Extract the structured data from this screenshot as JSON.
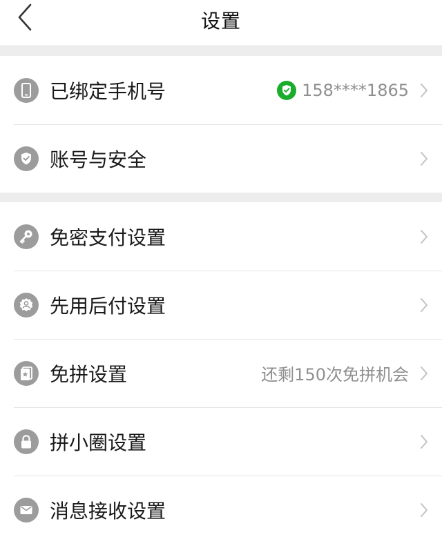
{
  "header": {
    "title": "设置",
    "back_icon": "chevron-left-icon"
  },
  "sections": [
    {
      "items": [
        {
          "label": "已绑定手机号",
          "icon": "phone-icon",
          "value": "158****1865",
          "value_icon": "verified-shield-icon",
          "value_icon_color": "#1aad2b"
        },
        {
          "label": "账号与安全",
          "icon": "shield-check-icon"
        }
      ]
    },
    {
      "items": [
        {
          "label": "免密支付设置",
          "icon": "key-icon"
        },
        {
          "label": "先用后付设置",
          "icon": "badge-person-icon"
        },
        {
          "label": "免拼设置",
          "icon": "card-star-icon",
          "value": "还剩150次免拼机会"
        },
        {
          "label": "拼小圈设置",
          "icon": "lock-icon"
        },
        {
          "label": "消息接收设置",
          "icon": "mail-icon"
        }
      ]
    }
  ],
  "colors": {
    "icon_bg": "#9c9c9c",
    "section_gap": "#ededed",
    "divider": "#e4e4e4",
    "secondary_text": "#8f8f8f",
    "verified": "#1aad2b"
  }
}
